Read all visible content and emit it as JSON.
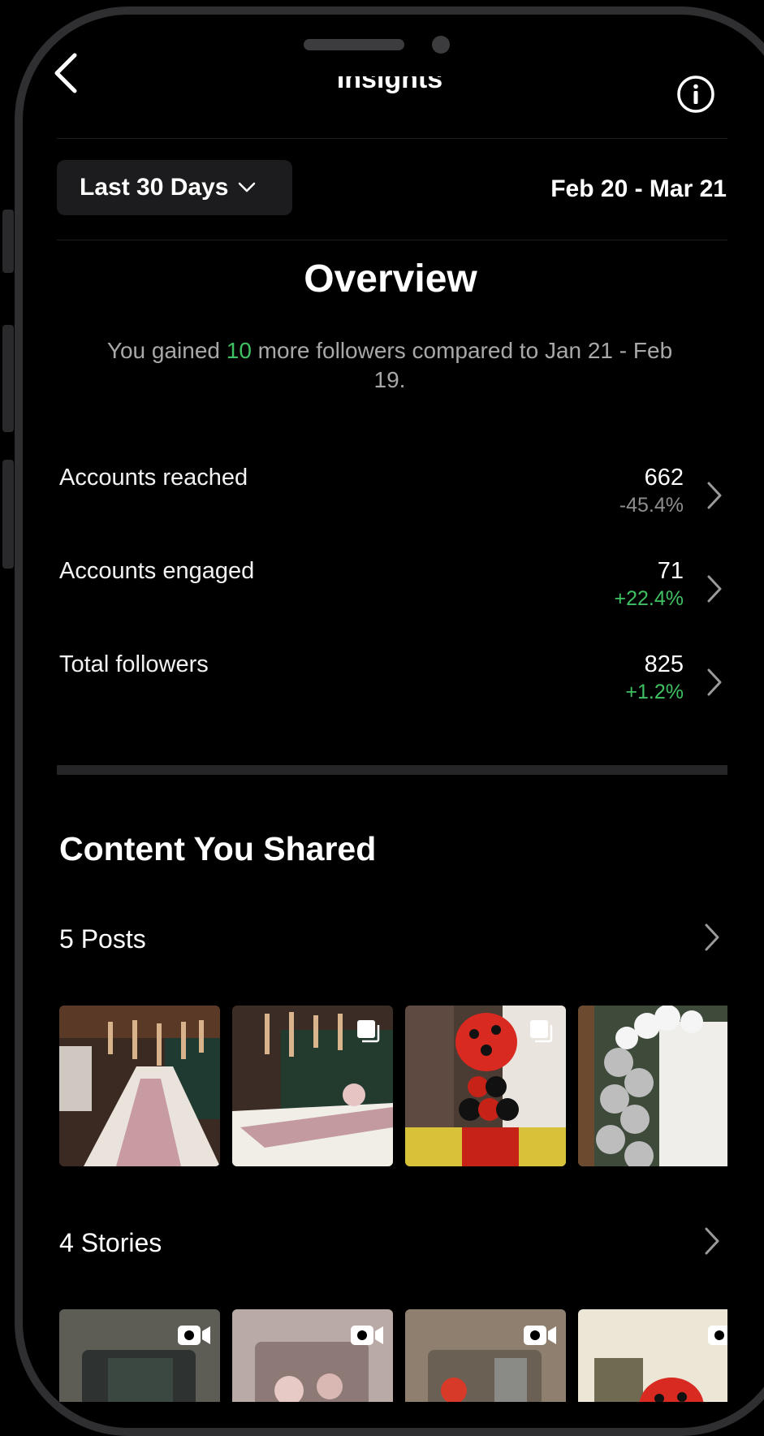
{
  "header": {
    "title": "Insights",
    "back_icon": "chevron-left-icon",
    "info_icon": "info-circle-icon"
  },
  "filter": {
    "range_label": "Last 30 Days",
    "date_range": "Feb 20 - Mar 21"
  },
  "overview": {
    "title": "Overview",
    "summary_prefix": "You gained ",
    "summary_count": "10",
    "summary_suffix": " more followers compared to Jan 21 - Feb 19."
  },
  "metrics": [
    {
      "label": "Accounts reached",
      "value": "662",
      "change": "-45.4%",
      "trend": "negative"
    },
    {
      "label": "Accounts engaged",
      "value": "71",
      "change": "+22.4%",
      "trend": "positive"
    },
    {
      "label": "Total followers",
      "value": "825",
      "change": "+1.2%",
      "trend": "positive"
    }
  ],
  "content": {
    "title": "Content You Shared",
    "posts_label": "5 Posts",
    "stories_label": "4 Stories"
  },
  "colors": {
    "positive": "#3fc163",
    "negative": "#8e8e8e",
    "background": "#000000",
    "button_bg": "#1c1c1e"
  }
}
